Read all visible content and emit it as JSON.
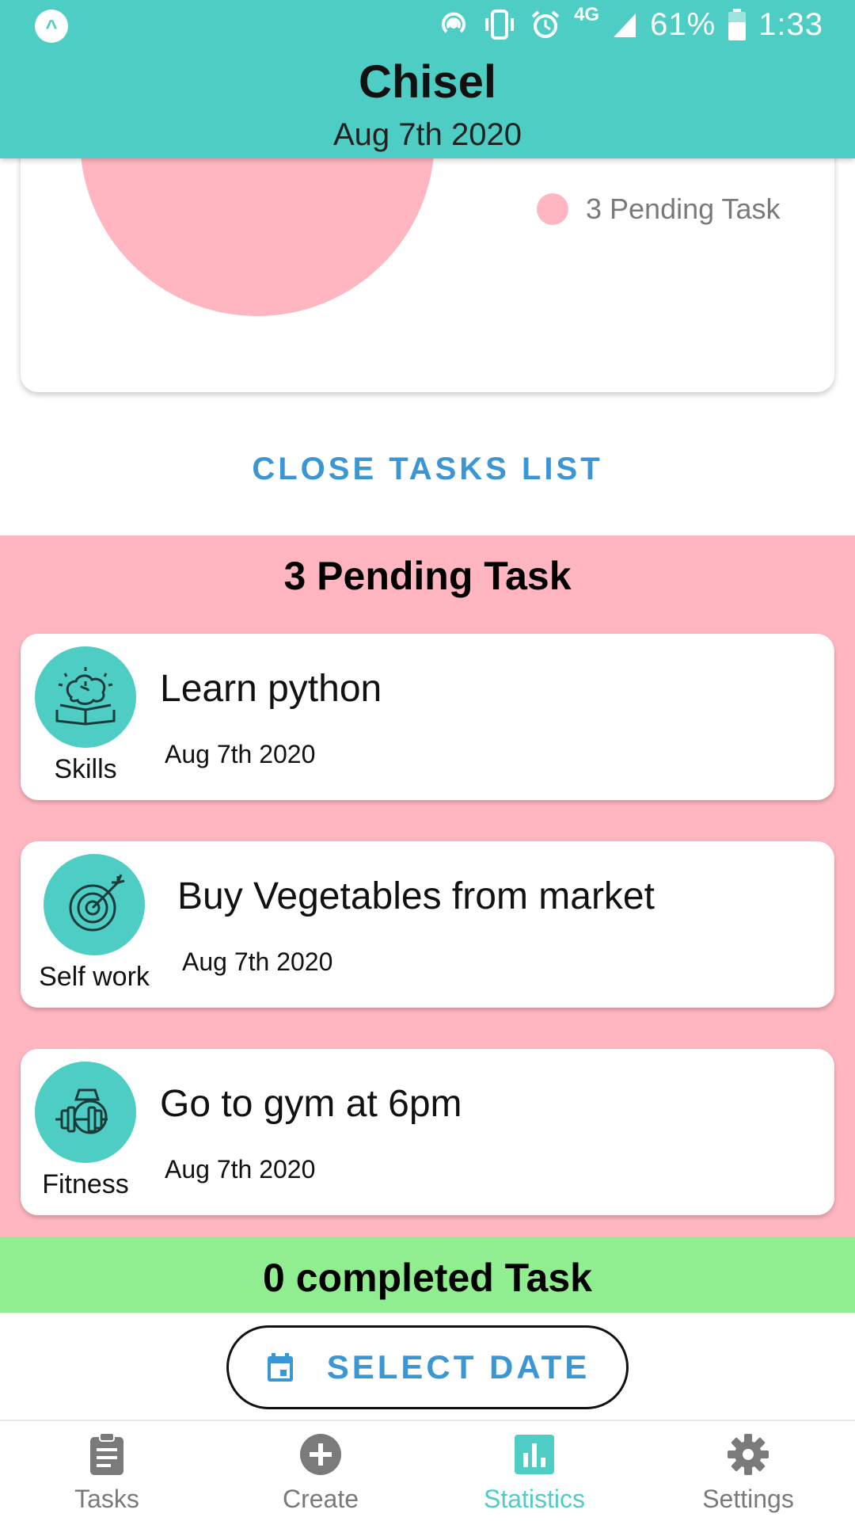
{
  "status_bar": {
    "battery": "61%",
    "time": "1:33",
    "network": "4G",
    "icons": [
      "app-badge-icon",
      "hotspot-icon",
      "vibrate-icon",
      "alarm-icon",
      "signal-icon",
      "battery-icon"
    ]
  },
  "header": {
    "title": "Chisel",
    "date": "Aug 7th 2020"
  },
  "chart_data": {
    "type": "pie",
    "labels": [
      "3 Pending Task"
    ],
    "values": [
      3
    ],
    "colors": [
      "#ffb6c1"
    ],
    "legend": "right"
  },
  "actions": {
    "close_list": "CLOSE TASKS LIST",
    "select_date": "SELECT DATE"
  },
  "pending": {
    "title": "3 Pending Task",
    "tasks": [
      {
        "title": "Learn python",
        "date": "Aug 7th 2020",
        "category": "Skills",
        "icon": "brain-book-icon"
      },
      {
        "title": "Buy Vegetables from market",
        "date": "Aug 7th 2020",
        "category": "Self work",
        "icon": "target-icon"
      },
      {
        "title": "Go to gym at 6pm",
        "date": "Aug 7th 2020",
        "category": "Fitness",
        "icon": "dumbbell-icon"
      }
    ]
  },
  "completed": {
    "title": "0 completed Task"
  },
  "nav": {
    "items": [
      {
        "label": "Tasks",
        "icon": "clipboard-icon",
        "active": false
      },
      {
        "label": "Create",
        "icon": "plus-circle-icon",
        "active": false
      },
      {
        "label": "Statistics",
        "icon": "bar-chart-icon",
        "active": true
      },
      {
        "label": "Settings",
        "icon": "gear-icon",
        "active": false
      }
    ]
  },
  "colors": {
    "header": "#4ecdc4",
    "accent_blue": "#3b97d3",
    "pending_bg": "#ffb6c1",
    "completed_bg": "#90ee90",
    "nav_inactive": "#7a7a7a",
    "nav_active": "#4ecdc4"
  }
}
